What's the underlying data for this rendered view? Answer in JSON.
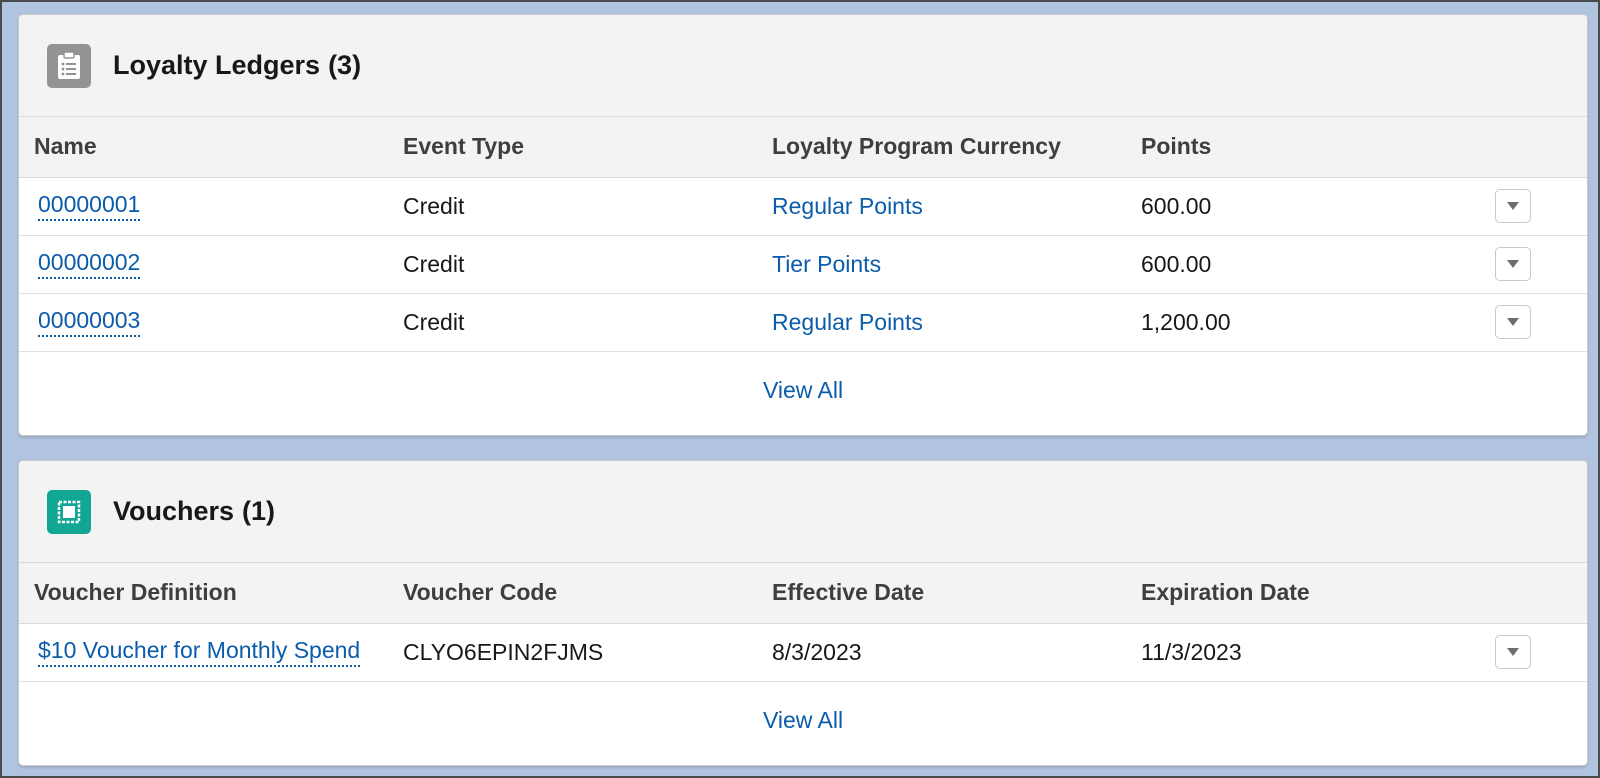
{
  "ledgers": {
    "title": "Loyalty Ledgers",
    "count": "(3)",
    "icon": "clipboard-list-icon",
    "columns": [
      "Name",
      "Event Type",
      "Loyalty Program Currency",
      "Points"
    ],
    "rows": [
      {
        "name": "00000001",
        "event_type": "Credit",
        "currency": "Regular Points",
        "points": "600.00"
      },
      {
        "name": "00000002",
        "event_type": "Credit",
        "currency": "Tier Points",
        "points": "600.00"
      },
      {
        "name": "00000003",
        "event_type": "Credit",
        "currency": "Regular Points",
        "points": "1,200.00"
      }
    ],
    "view_all": "View All"
  },
  "vouchers": {
    "title": "Vouchers",
    "count": "(1)",
    "icon": "voucher-icon",
    "columns": [
      "Voucher Definition",
      "Voucher Code",
      "Effective Date",
      "Expiration Date"
    ],
    "rows": [
      {
        "definition": "$10 Voucher for Monthly Spend",
        "code": "CLYO6EPIN2FJMS",
        "effective": "8/3/2023",
        "expiration": "11/3/2023"
      }
    ],
    "view_all": "View All"
  },
  "colors": {
    "link": "#0b5cab",
    "ledger_icon_bg": "#939393",
    "voucher_icon_bg": "#12a795",
    "page_bg": "#b0c4df"
  }
}
